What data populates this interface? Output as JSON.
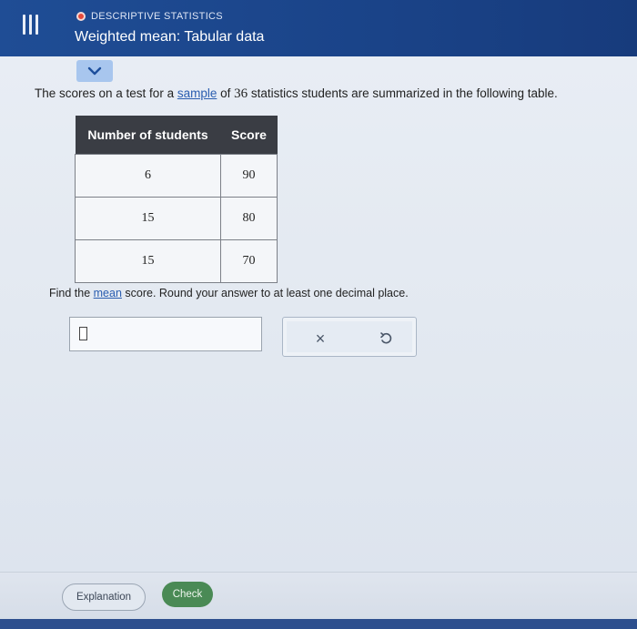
{
  "header": {
    "topic": "DESCRIPTIVE STATISTICS",
    "title": "Weighted mean: Tabular data"
  },
  "question": {
    "text_before": "The scores on a test for a ",
    "link_sample": "sample",
    "text_middle": " of ",
    "count": "36",
    "text_after": " statistics students are summarized in the following table."
  },
  "table": {
    "headers": [
      "Number of students",
      "Score"
    ],
    "rows": [
      [
        "6",
        "90"
      ],
      [
        "15",
        "80"
      ],
      [
        "15",
        "70"
      ]
    ]
  },
  "instruction": {
    "before": "Find the ",
    "link_mean": "mean",
    "after": " score. Round your answer to at least one decimal place."
  },
  "answer": {
    "value": ""
  },
  "tools": {
    "clear_symbol": "×"
  },
  "footer": {
    "explanation_label": "Explanation",
    "check_label": "Check"
  },
  "icons": {
    "menu": "menu-icon",
    "topic_dot": "topic-dot-icon",
    "collapse": "chevron-down-icon",
    "clear": "close-icon",
    "undo": "undo-icon"
  },
  "colors": {
    "header_bg": "#1f4d95",
    "link": "#2a5db0",
    "table_header": "#3a3d44",
    "check_button": "#4a8a55"
  }
}
